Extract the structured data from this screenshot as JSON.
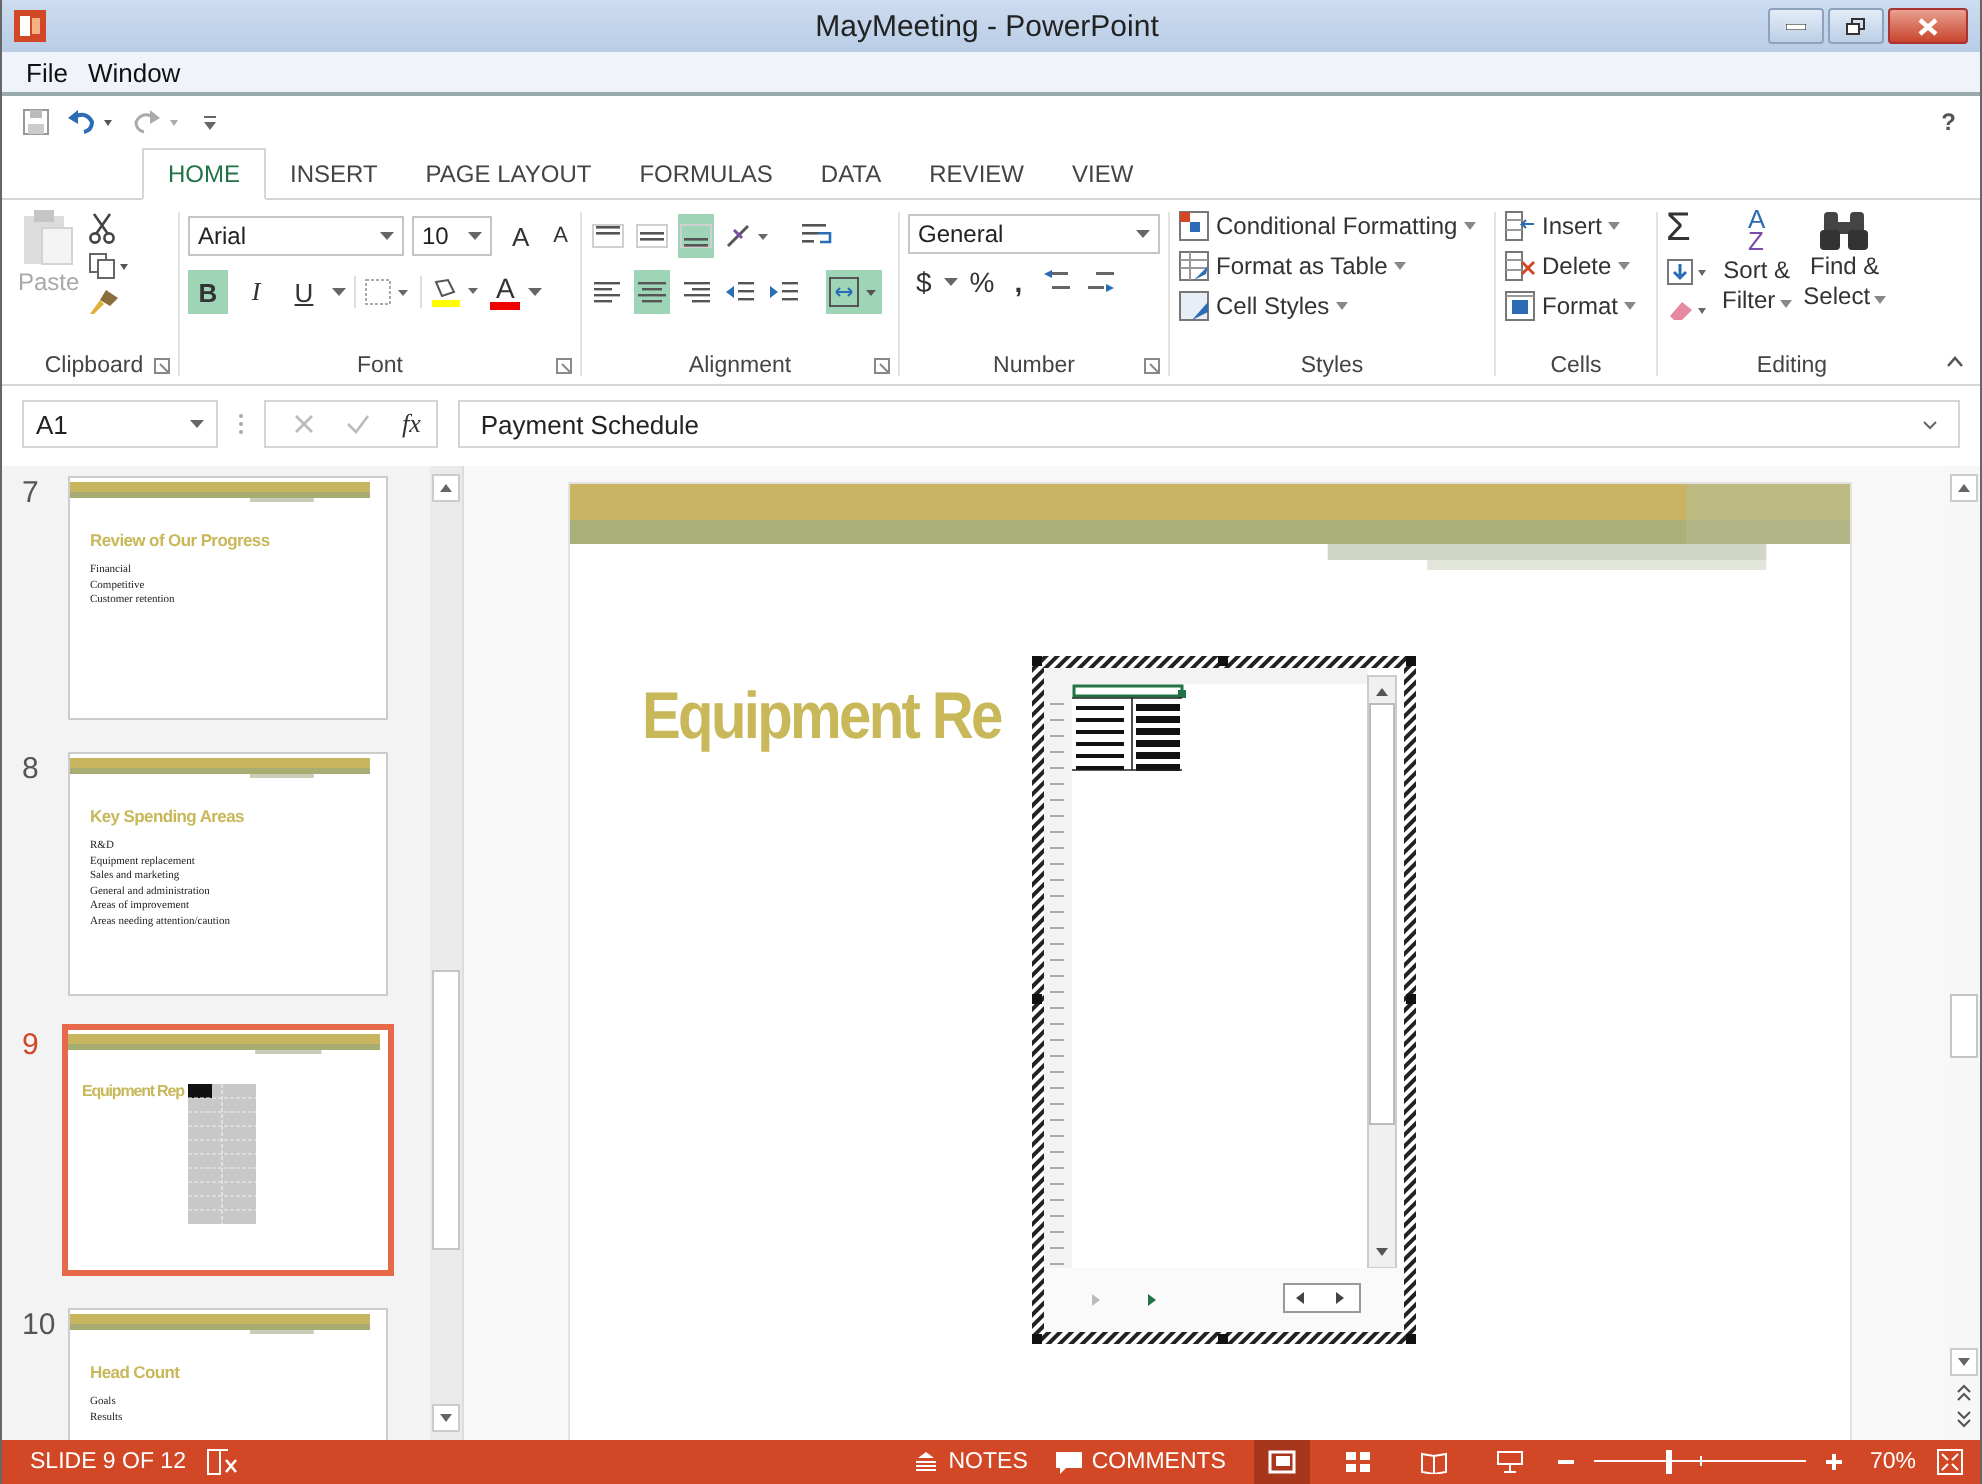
{
  "window": {
    "title": "MayMeeting - PowerPoint"
  },
  "menu": [
    {
      "label": "File"
    },
    {
      "label": "Window"
    }
  ],
  "help": "?",
  "tabs": [
    {
      "label": "HOME",
      "selected": true
    },
    {
      "label": "INSERT",
      "selected": false
    },
    {
      "label": "PAGE LAYOUT",
      "selected": false
    },
    {
      "label": "FORMULAS",
      "selected": false
    },
    {
      "label": "DATA",
      "selected": false
    },
    {
      "label": "REVIEW",
      "selected": false
    },
    {
      "label": "VIEW",
      "selected": false
    }
  ],
  "ribbon": {
    "clipboard": {
      "label": "Clipboard",
      "paste": "Paste",
      "disabled": true
    },
    "font": {
      "label": "Font",
      "family": "Arial",
      "size": "10",
      "grow": "A",
      "shrink": "A",
      "color_letter": "A",
      "buttons": [
        {
          "kind": "bold",
          "label": "B",
          "selected": true
        },
        {
          "kind": "italic",
          "label": "I",
          "selected": false
        },
        {
          "kind": "underline",
          "label": "U",
          "selected": false
        }
      ]
    },
    "alignment": {
      "label": "Alignment",
      "rows": [
        [
          {
            "kind": "top",
            "selected": false
          },
          {
            "kind": "middle",
            "selected": false
          },
          {
            "kind": "bottom",
            "selected": true
          },
          {
            "kind": "orientation",
            "selected": false
          },
          {
            "kind": "wrap",
            "selected": false
          }
        ],
        [
          {
            "kind": "left",
            "selected": false
          },
          {
            "kind": "center",
            "selected": true
          },
          {
            "kind": "right",
            "selected": false
          },
          {
            "kind": "outdent",
            "selected": false
          },
          {
            "kind": "indent",
            "selected": false
          },
          {
            "kind": "merge",
            "selected": true
          }
        ]
      ]
    },
    "number": {
      "label": "Number",
      "format": "General",
      "currency": "$",
      "percent": "%",
      "comma": ","
    },
    "styles": {
      "label": "Styles",
      "items": [
        {
          "kind": "conditional",
          "label": "Conditional Formatting"
        },
        {
          "kind": "table",
          "label": "Format as Table"
        },
        {
          "kind": "cell",
          "label": "Cell Styles"
        }
      ]
    },
    "cells": {
      "label": "Cells",
      "items": [
        {
          "kind": "insert",
          "label": "Insert"
        },
        {
          "kind": "delete",
          "label": "Delete"
        },
        {
          "kind": "format",
          "label": "Format"
        }
      ]
    },
    "editing": {
      "label": "Editing",
      "sum": "Σ",
      "az": [
        "A",
        "Z"
      ],
      "sort": [
        "Sort &",
        "Filter"
      ],
      "find": [
        "Find &",
        "Select"
      ]
    }
  },
  "formula_bar": {
    "name_box": "A1",
    "fx": "fx",
    "value": "Payment Schedule"
  },
  "thumbnails": [
    {
      "number": "7",
      "kind": "bullets",
      "title": "Review of Our Progress",
      "bullets": [
        "Financial",
        "Competitive",
        "Customer retention"
      ],
      "selected": false
    },
    {
      "number": "8",
      "kind": "bullets",
      "title": "Key Spending Areas",
      "bullets": [
        "R&D",
        "Equipment replacement",
        "Sales and marketing",
        "General and administration",
        "Areas of improvement",
        "Areas needing attention/caution"
      ],
      "selected": false
    },
    {
      "number": "9",
      "kind": "table",
      "title": "Equipment Rep",
      "selected": true
    },
    {
      "number": "10",
      "kind": "bullets",
      "title": "Head Count",
      "bullets": [
        "Goals",
        "Results"
      ],
      "selected": false
    }
  ],
  "slide": {
    "title": "Equipment Re"
  },
  "status_bar": {
    "slide": "SLIDE 9 OF 12",
    "notes": "NOTES",
    "comments": "COMMENTS",
    "views": [
      {
        "kind": "normal",
        "selected": true
      },
      {
        "kind": "sorter",
        "selected": false
      },
      {
        "kind": "reading",
        "selected": false
      },
      {
        "kind": "slideshow",
        "selected": false
      }
    ],
    "zoom": {
      "level": 0.35,
      "label": "70%"
    }
  }
}
